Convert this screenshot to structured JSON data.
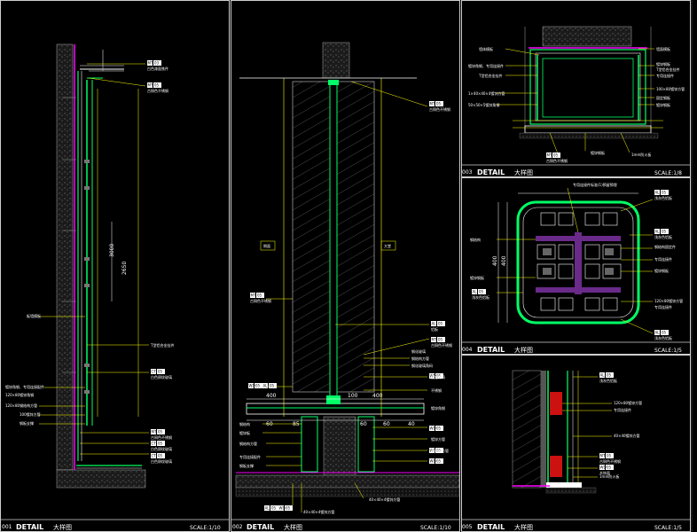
{
  "panels": [
    {
      "num": "001",
      "title": "DETAIL",
      "title_cn": "大样图",
      "scale": "SCALE:1/10"
    },
    {
      "num": "002",
      "title": "DETAIL",
      "title_cn": "大样图",
      "scale": "SCALE:1/10"
    },
    {
      "num": "003",
      "title": "DETAIL",
      "title_cn": "大样图",
      "scale": "SCALE:1/8"
    },
    {
      "num": "004",
      "title": "DETAIL",
      "title_cn": "大样图",
      "scale": "SCALE:1/5"
    },
    {
      "num": "005",
      "title": "DETAIL",
      "title_cn": "大样图",
      "scale": "SCALE:1/5"
    }
  ],
  "tags": {
    "p1": [
      {
        "code": "MT",
        "num": "03",
        "text": "白色漆面铁件"
      },
      {
        "code": "MT",
        "num": "05",
        "text": "古铜色不锈钢"
      },
      {
        "code": "MT",
        "num": "05",
        "text": "古铜色不锈钢"
      },
      {
        "code": "MT",
        "num": "05",
        "text": "古铜色不锈钢"
      },
      {
        "code": "CT",
        "num": "05",
        "text": "白色卵纹玻璃"
      },
      {
        "code": "CT",
        "num": "05",
        "text": "白色卵纹玻璃"
      },
      {
        "code": "CT",
        "num": "05",
        "text": "白色卵纹玻璃"
      }
    ],
    "p2": [
      {
        "code": "MT",
        "num": "05",
        "text": "古铜色不锈钢"
      },
      {
        "code": "MT",
        "num": "05",
        "text": "古铜色不锈钢"
      },
      {
        "code": "AL",
        "num": "05",
        "text": "铝板"
      },
      {
        "code": "MT",
        "num": "05",
        "text": "古铜色不锈钢"
      },
      {
        "code": "WD",
        "num": "05",
        "text": "木饰面"
      },
      {
        "code": "AL",
        "num": "05",
        "text": "浅灰色铝板"
      },
      {
        "code": "WD",
        "num": "05",
        "text": "木饰面"
      },
      {
        "code": "AL",
        "num": "05",
        "text": "铝板"
      },
      {
        "code": "AL",
        "num": "05",
        "text": "铝板"
      },
      {
        "code": "WD",
        "num": "05",
        "text": "木饰面"
      },
      {
        "code": "WD",
        "num": "05",
        "text": "木饰面"
      },
      {
        "code": "WD",
        "num": "05",
        "text": "木饰面"
      },
      {
        "code": "AL",
        "num": "05",
        "text": "浅灰色铝板"
      },
      {
        "code": "WD",
        "num": "05",
        "text": "木饰面"
      }
    ],
    "p3": [
      {
        "code": "MT",
        "num": "05",
        "text": "古铜色不锈钢"
      }
    ],
    "p4": [
      {
        "code": "AL",
        "num": "05",
        "text": "浅灰色铝板"
      },
      {
        "code": "AL",
        "num": "05",
        "text": "浅灰色铝板"
      },
      {
        "code": "AL",
        "num": "05",
        "text": "浅灰色铝板"
      },
      {
        "code": "AL",
        "num": "05",
        "text": "浅灰色铝板"
      }
    ],
    "p5": [
      {
        "code": "AL",
        "num": "05",
        "text": "浅灰色铝板"
      },
      {
        "code": "MT",
        "num": "05",
        "text": "古铜色不锈钢"
      },
      {
        "code": "WD",
        "num": "05",
        "text": "木饰面"
      }
    ]
  },
  "notes": {
    "p1": [
      "板墙模板",
      "T型铝合金挂件",
      "镀锌角钢、专用连接配件",
      "120×80镀锌角钢",
      "钢板支撑",
      "120×80钢结构方管",
      "100镀锌方管"
    ],
    "p2": [
      "防火板",
      "侧面",
      "天花板",
      "大堂",
      "钢化玻璃",
      "钢结构方管",
      "钢化玻璃角码",
      "固定角码",
      "不锈钢",
      "镀锌角钢",
      "钢结构",
      "镀锌板",
      "40×40×4镀锌方管",
      "钢结构方管",
      "专用连接配件",
      "钢板支撑",
      "镀锌方管",
      "40×40×4镀锌方管",
      "钢结构方管"
    ],
    "p3": [
      "墙体模板",
      "镀锌角钢、专用连接件",
      "T型铝合金挂件",
      "1×40×40×4镀锌方管",
      "50×50×5镀锌角钢",
      "墙面模板",
      "镀锌钢板",
      "T型铝合金挂件",
      "专用连接件",
      "100×80镀锌方管",
      "固定钢板",
      "镀锌钢板",
      "1mm防火板"
    ],
    "p4": [
      "专用连接件标准(1)预留预埋",
      "钢结构",
      "镀锌钢板",
      "钢结构固定件",
      "专用连接件",
      "镀锌钢板",
      "专用连接件",
      "120×80镀锌方管",
      "120×80镀锌角钢",
      "40×40镀锌方管",
      "专用连接件",
      "400",
      "400"
    ],
    "p5": [
      "120×80镀锌方管",
      "专用连接件",
      "40×40镀锌方管",
      "1mm防火板"
    ]
  },
  "dims": {
    "p1": [
      "3000",
      "2650"
    ],
    "p2": [
      "400",
      "400",
      "100",
      "60",
      "85",
      "60",
      "60",
      "40"
    ],
    "p4": [
      "400",
      "400"
    ]
  }
}
